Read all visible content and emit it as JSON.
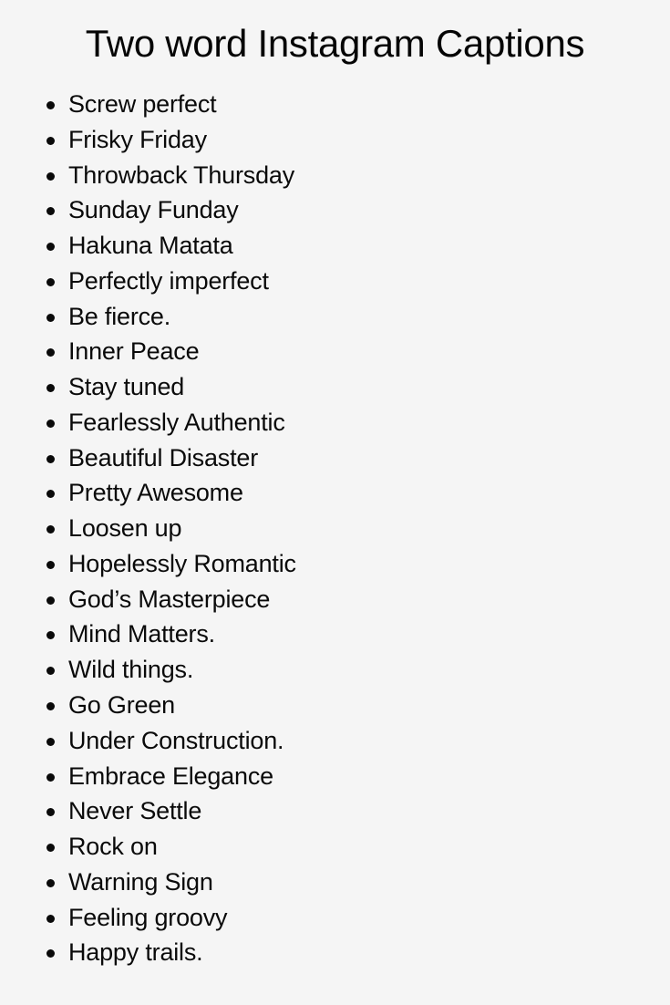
{
  "page": {
    "title": "Two word Instagram Captions",
    "background_color": "#f5f5f5",
    "text_color": "#0a0a0a"
  },
  "captions": [
    {
      "text": "Screw perfect"
    },
    {
      "text": "Frisky Friday"
    },
    {
      "text": "Throwback Thursday"
    },
    {
      "text": "Sunday Funday"
    },
    {
      "text": "Hakuna Matata"
    },
    {
      "text": "Perfectly imperfect"
    },
    {
      "text": "Be fierce."
    },
    {
      "text": "Inner Peace"
    },
    {
      "text": "Stay tuned"
    },
    {
      "text": "Fearlessly Authentic"
    },
    {
      "text": "Beautiful Disaster"
    },
    {
      "text": "Pretty Awesome"
    },
    {
      "text": "Loosen up"
    },
    {
      "text": "Hopelessly Romantic"
    },
    {
      "text": "God’s Masterpiece"
    },
    {
      "text": "Mind Matters."
    },
    {
      "text": "Wild things."
    },
    {
      "text": "Go Green"
    },
    {
      "text": "Under Construction."
    },
    {
      "text": "Embrace Elegance"
    },
    {
      "text": "Never Settle"
    },
    {
      "text": "Rock on"
    },
    {
      "text": "Warning Sign"
    },
    {
      "text": "Feeling groovy"
    },
    {
      "text": "Happy trails."
    }
  ]
}
